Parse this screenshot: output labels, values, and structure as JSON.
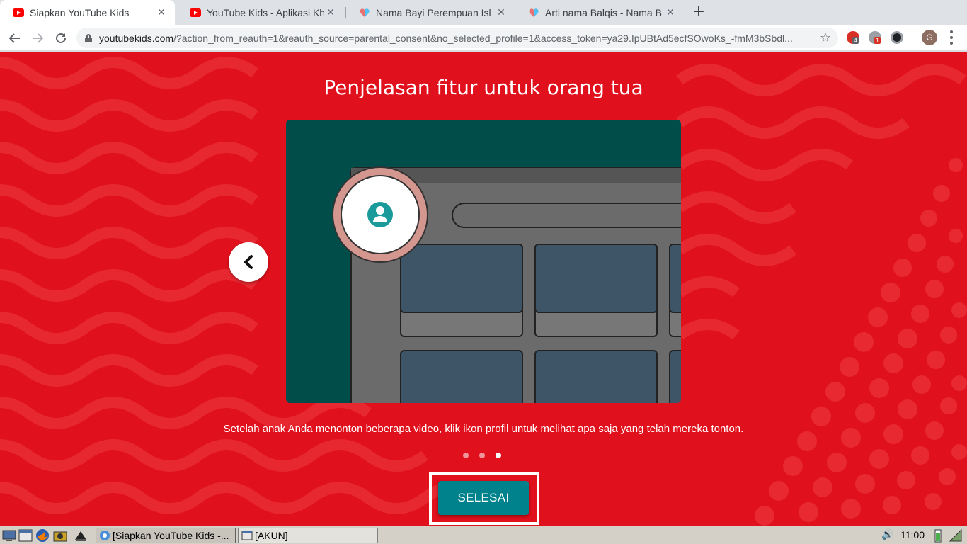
{
  "browser": {
    "tabs": [
      {
        "title": "Siapkan YouTube Kids",
        "favicon": "youtube-icon",
        "active": true
      },
      {
        "title": "YouTube Kids - Aplikasi Kh",
        "favicon": "youtube-icon",
        "active": false
      },
      {
        "title": "Nama Bayi Perempuan Isl",
        "favicon": "heart-icon",
        "active": false
      },
      {
        "title": "Arti nama Balqis - Nama B",
        "favicon": "heart-icon",
        "active": false
      }
    ],
    "new_tab_label": "+",
    "url_host": "youtubekids.com",
    "url_rest": "/?action_from_reauth=1&reauth_source=parental_consent&no_selected_profile=1&access_token=ya29.IpUBtAd5ecfSOwoKs_-fmM3bSbdl...",
    "extension_badges": {
      "first": "4",
      "second": "1"
    },
    "profile_initial": "G"
  },
  "page": {
    "title": "Penjelasan fitur untuk orang tua",
    "description": "Setelah anak Anda menonton beberapa video, klik ikon profil untuk melihat apa saja yang telah mereka tonton.",
    "carousel": {
      "total": 3,
      "current": 3
    },
    "done_label": "SELESAI",
    "colors": {
      "background": "#e0101c",
      "card": "#004d4a",
      "button": "#00828c"
    }
  },
  "taskbar": {
    "tasks": [
      {
        "label": "[Siapkan YouTube Kids -...",
        "active": true
      },
      {
        "label": "[AKUN]",
        "active": false
      }
    ],
    "clock": "11:00"
  }
}
